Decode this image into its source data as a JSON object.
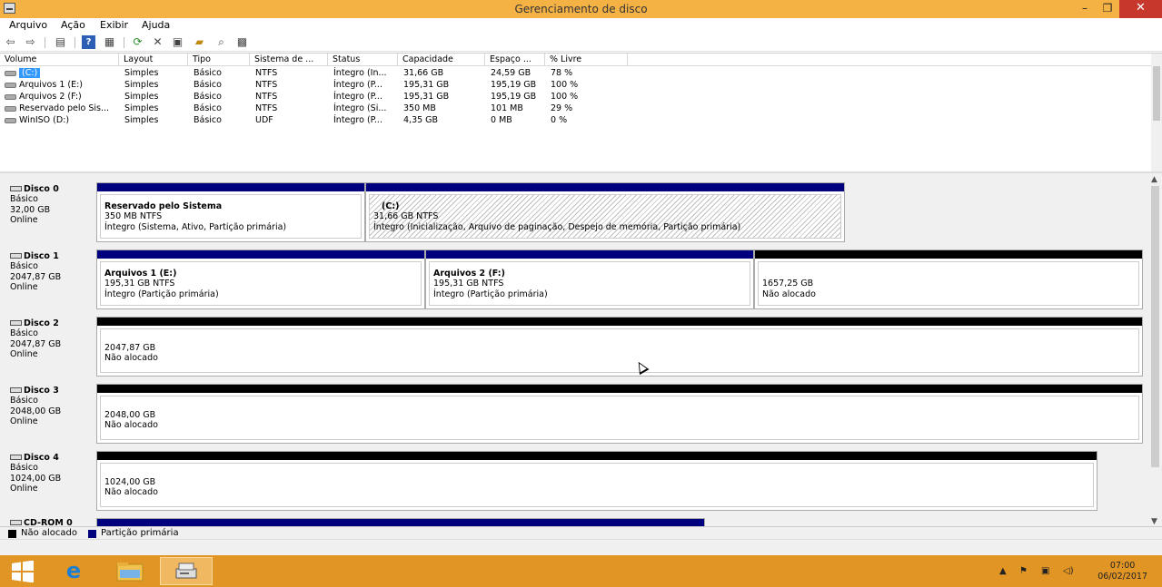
{
  "window": {
    "title": "Gerenciamento de disco",
    "minimize": "–",
    "restore": "❐",
    "close": "✕"
  },
  "menu": [
    "Arquivo",
    "Ação",
    "Exibir",
    "Ajuda"
  ],
  "toolbar": {
    "icons": [
      "back-icon",
      "forward-icon",
      "properties-pane-icon",
      "help-icon",
      "view-icon",
      "refresh-icon",
      "delete-icon",
      "properties-icon",
      "open-icon",
      "explore-icon",
      "settings-icon"
    ]
  },
  "columns": [
    "Volume",
    "Layout",
    "Tipo",
    "Sistema de ...",
    "Status",
    "Capacidade",
    "Espaço ...",
    "% Livre"
  ],
  "volumes": [
    {
      "name": "(C:)",
      "layout": "Simples",
      "tipo": "Básico",
      "fs": "NTFS",
      "status": "Íntegro (In...",
      "cap": "31,66 GB",
      "free": "24,59 GB",
      "pct": "78 %",
      "selected": true
    },
    {
      "name": "Arquivos 1 (E:)",
      "layout": "Simples",
      "tipo": "Básico",
      "fs": "NTFS",
      "status": "Íntegro (P...",
      "cap": "195,31 GB",
      "free": "195,19 GB",
      "pct": "100 %"
    },
    {
      "name": "Arquivos 2 (F:)",
      "layout": "Simples",
      "tipo": "Básico",
      "fs": "NTFS",
      "status": "Íntegro (P...",
      "cap": "195,31 GB",
      "free": "195,19 GB",
      "pct": "100 %"
    },
    {
      "name": "Reservado pelo Sis...",
      "layout": "Simples",
      "tipo": "Básico",
      "fs": "NTFS",
      "status": "Íntegro (Si...",
      "cap": "350 MB",
      "free": "101 MB",
      "pct": "29 %"
    },
    {
      "name": "WinISO (D:)",
      "layout": "Simples",
      "tipo": "Básico",
      "fs": "UDF",
      "status": "Íntegro (P...",
      "cap": "4,35 GB",
      "free": "0 MB",
      "pct": "0 %"
    }
  ],
  "disks": [
    {
      "name": "Disco 0",
      "type": "Básico",
      "size": "32,00 GB",
      "status": "Online",
      "parts": [
        {
          "title": "Reservado pelo Sistema",
          "line1": "350 MB NTFS",
          "line2": "Íntegro (Sistema, Ativo, Partição primária)"
        },
        {
          "title": "(C:)",
          "line1": "31,66 GB NTFS",
          "line2": "Íntegro (Inicialização, Arquivo de paginação, Despejo de memória, Partição primária)"
        }
      ]
    },
    {
      "name": "Disco 1",
      "type": "Básico",
      "size": "2047,87 GB",
      "status": "Online",
      "parts": [
        {
          "title": "Arquivos 1  (E:)",
          "line1": "195,31 GB NTFS",
          "line2": "Íntegro (Partição primária)"
        },
        {
          "title": "Arquivos 2  (F:)",
          "line1": "195,31 GB NTFS",
          "line2": "Íntegro (Partição primária)"
        },
        {
          "title": "",
          "line1": "1657,25 GB",
          "line2": "Não alocado"
        }
      ]
    },
    {
      "name": "Disco 2",
      "type": "Básico",
      "size": "2047,87 GB",
      "status": "Online",
      "parts": [
        {
          "title": "",
          "line1": "2047,87 GB",
          "line2": "Não alocado"
        }
      ]
    },
    {
      "name": "Disco 3",
      "type": "Básico",
      "size": "2048,00 GB",
      "status": "Online",
      "parts": [
        {
          "title": "",
          "line1": "2048,00 GB",
          "line2": "Não alocado"
        }
      ]
    },
    {
      "name": "Disco 4",
      "type": "Básico",
      "size": "1024,00 GB",
      "status": "Online",
      "parts": [
        {
          "title": "",
          "line1": "1024,00 GB",
          "line2": "Não alocado"
        }
      ]
    },
    {
      "name": "CD-ROM 0"
    }
  ],
  "legend": {
    "unallocated": "Não alocado",
    "primary": "Partição primária",
    "colors": {
      "unallocated": "#000000",
      "primary": "#00007f"
    }
  },
  "taskbar": {
    "time": "07:00",
    "date": "06/02/2017"
  }
}
